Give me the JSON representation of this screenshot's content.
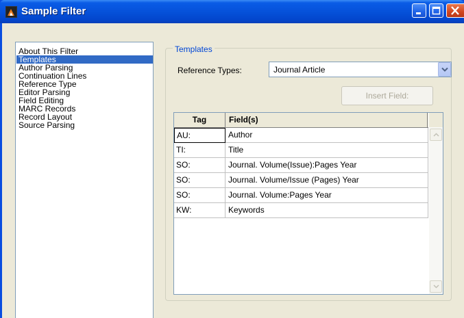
{
  "window": {
    "title": "Sample Filter"
  },
  "sidebar": {
    "items": [
      {
        "label": "About This Filter",
        "selected": false
      },
      {
        "label": "Templates",
        "selected": true
      },
      {
        "label": "Author Parsing",
        "selected": false
      },
      {
        "label": "Continuation Lines",
        "selected": false
      },
      {
        "label": "Reference Type",
        "selected": false
      },
      {
        "label": "Editor Parsing",
        "selected": false
      },
      {
        "label": "Field Editing",
        "selected": false
      },
      {
        "label": "MARC Records",
        "selected": false
      },
      {
        "label": "Record Layout",
        "selected": false
      },
      {
        "label": "Source Parsing",
        "selected": false
      }
    ]
  },
  "templates": {
    "group_label": "Templates",
    "reference_types_label": "Reference Types:",
    "reference_type_value": "Journal Article",
    "insert_field_label": "Insert Field:",
    "columns": {
      "tag": "Tag",
      "fields": "Field(s)"
    },
    "rows": [
      {
        "tag": "AU:",
        "field": "Author"
      },
      {
        "tag": "TI:",
        "field": "Title"
      },
      {
        "tag": "SO:",
        "field": "Journal. Volume(Issue):Pages Year"
      },
      {
        "tag": "SO:",
        "field": "Journal. Volume/Issue (Pages) Year"
      },
      {
        "tag": "SO:",
        "field": "Journal. Volume:Pages Year"
      },
      {
        "tag": "KW:",
        "field": "Keywords"
      }
    ]
  },
  "colors": {
    "titlebar": "#0550d8",
    "selection": "#316ac5",
    "group_label": "#0046d5",
    "face": "#ece9d8"
  }
}
